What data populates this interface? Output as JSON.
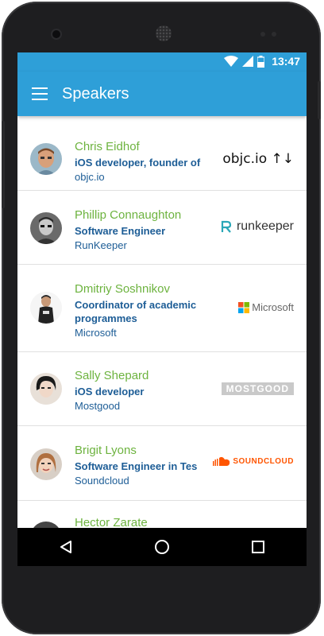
{
  "status": {
    "time": "13:47"
  },
  "appbar": {
    "title": "Speakers"
  },
  "speakers": [
    {
      "name": "Chris Eidhof",
      "role_line1": "iOS developer, founder of",
      "company": " objc.io",
      "logo_text": "objc.io ↑↓"
    },
    {
      "name": "Phillip Connaughton",
      "role_line1": "Software Engineer",
      "company": "RunKeeper",
      "logo_text": "runkeeper"
    },
    {
      "name": "Dmitriy Soshnikov",
      "role_line1": "Coordinator of academic programmes",
      "company": "Microsoft",
      "logo_text": "Microsoft"
    },
    {
      "name": "Sally Shepard",
      "role_line1": "iOS developer",
      "company": "Mostgood",
      "logo_text": "MOSTGOOD"
    },
    {
      "name": "Brigit Lyons",
      "role_line1": "Software Engineer in Tes",
      "company": "Soundcloud",
      "logo_text": "SOUNDCLOUD"
    },
    {
      "name": "Hector Zarate"
    }
  ],
  "colors": {
    "primary": "#2e9fd8",
    "name_green": "#6db33f",
    "role_blue": "#1d5d96"
  },
  "icons": [
    "wifi-icon",
    "signal-icon",
    "battery-icon",
    "menu-icon",
    "back-icon",
    "home-icon",
    "recents-icon"
  ]
}
